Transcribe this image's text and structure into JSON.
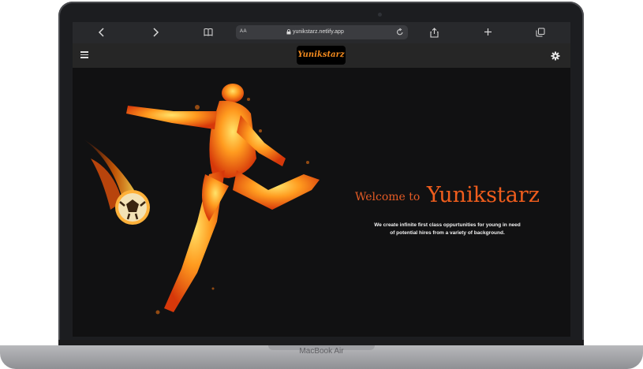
{
  "device": {
    "label": "MacBook Air"
  },
  "browser": {
    "address_prefix": "AA",
    "url": "yunikstarz.netlify.app",
    "icons": [
      "back-icon",
      "forward-icon",
      "book-icon",
      "lock-icon",
      "reload-icon",
      "share-icon",
      "plus-icon",
      "tabs-icon"
    ]
  },
  "site": {
    "logo_text": "Yunikstarz",
    "menu_icon": "hamburger-icon",
    "settings_icon": "gear-icon",
    "hero": {
      "welcome_prefix": "Welcome to",
      "welcome_name": "Yunikstarz",
      "description": "We create infinite first class oppurtunities for young in need of potential hires from a variety of background."
    },
    "colors": {
      "accent": "#ef5d1d",
      "background": "#111112",
      "header": "#262626"
    }
  }
}
